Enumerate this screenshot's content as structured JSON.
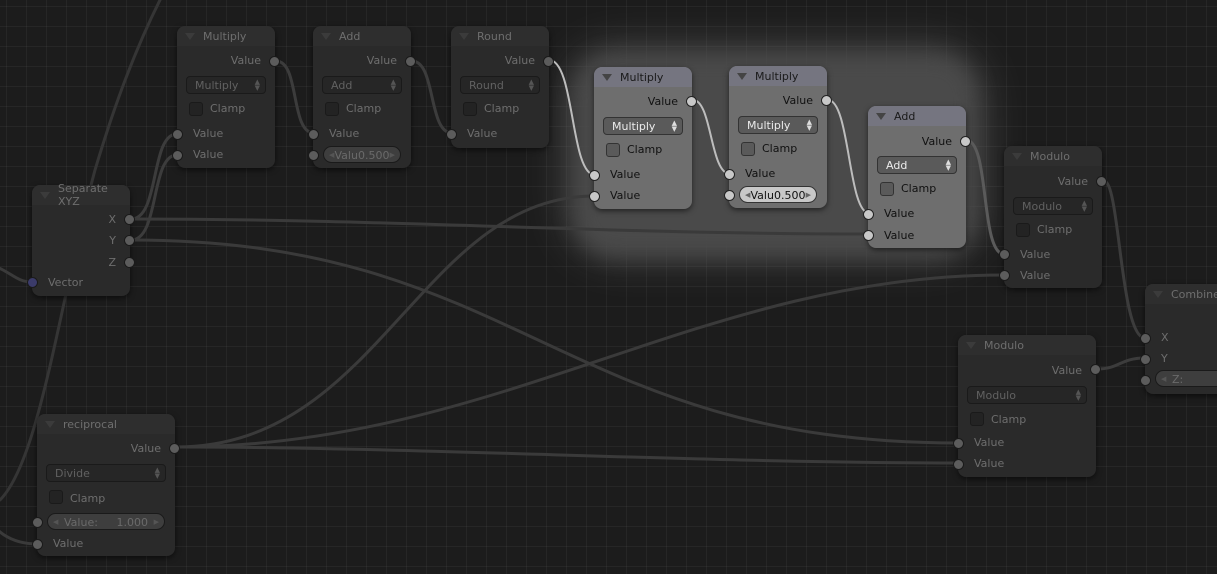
{
  "editor": "node-editor",
  "nodes": {
    "multiply1": {
      "title": "Multiply",
      "output": "Value",
      "operation": "Multiply",
      "clamp_label": "Clamp",
      "clamp": false,
      "inputs": [
        "Value",
        "Value"
      ],
      "selected": false
    },
    "add1": {
      "title": "Add",
      "output": "Value",
      "operation": "Add",
      "clamp_label": "Clamp",
      "clamp": false,
      "inputs": [
        "Value"
      ],
      "field_label": "Valu",
      "field_value": "0.500",
      "selected": false
    },
    "round1": {
      "title": "Round",
      "output": "Value",
      "operation": "Round",
      "clamp_label": "Clamp",
      "clamp": false,
      "inputs": [
        "Value"
      ],
      "selected": false
    },
    "multiply2": {
      "title": "Multiply",
      "output": "Value",
      "operation": "Multiply",
      "clamp_label": "Clamp",
      "clamp": false,
      "inputs": [
        "Value",
        "Value"
      ],
      "selected": true
    },
    "multiply3": {
      "title": "Multiply",
      "output": "Value",
      "operation": "Multiply",
      "clamp_label": "Clamp",
      "clamp": false,
      "inputs": [
        "Value"
      ],
      "field_label": "Valu",
      "field_value": "0.500",
      "selected": true
    },
    "add2": {
      "title": "Add",
      "output": "Value",
      "operation": "Add",
      "clamp_label": "Clamp",
      "clamp": false,
      "inputs": [
        "Value",
        "Value"
      ],
      "selected": true
    },
    "modulo1": {
      "title": "Modulo",
      "output": "Value",
      "operation": "Modulo",
      "clamp_label": "Clamp",
      "clamp": false,
      "inputs": [
        "Value",
        "Value"
      ],
      "selected": false
    },
    "separate": {
      "title": "Separate XYZ",
      "outputs": [
        "X",
        "Y",
        "Z"
      ],
      "input": "Vector",
      "selected": false
    },
    "reciprocal": {
      "title": "reciprocal",
      "output": "Value",
      "operation": "Divide",
      "clamp_label": "Clamp",
      "clamp": false,
      "field_label": "Value:",
      "field_value": "1.000",
      "inputs": [
        "Value"
      ],
      "selected": false
    },
    "modulo2": {
      "title": "Modulo",
      "output": "Value",
      "operation": "Modulo",
      "clamp_label": "Clamp",
      "clamp": false,
      "inputs": [
        "Value",
        "Value"
      ],
      "selected": false
    },
    "combine": {
      "title": "Combine X",
      "inputs": [
        "X",
        "Y"
      ],
      "field_label": "Z:",
      "selected": false
    }
  },
  "colors": {
    "background": "#1c1c1c",
    "node_body": "#2a2a2a",
    "node_selected": "#6e6e6e",
    "link": "#3c3c3c",
    "link_selected": "#bdbdbd",
    "vector_socket": "#3b3b6a"
  }
}
